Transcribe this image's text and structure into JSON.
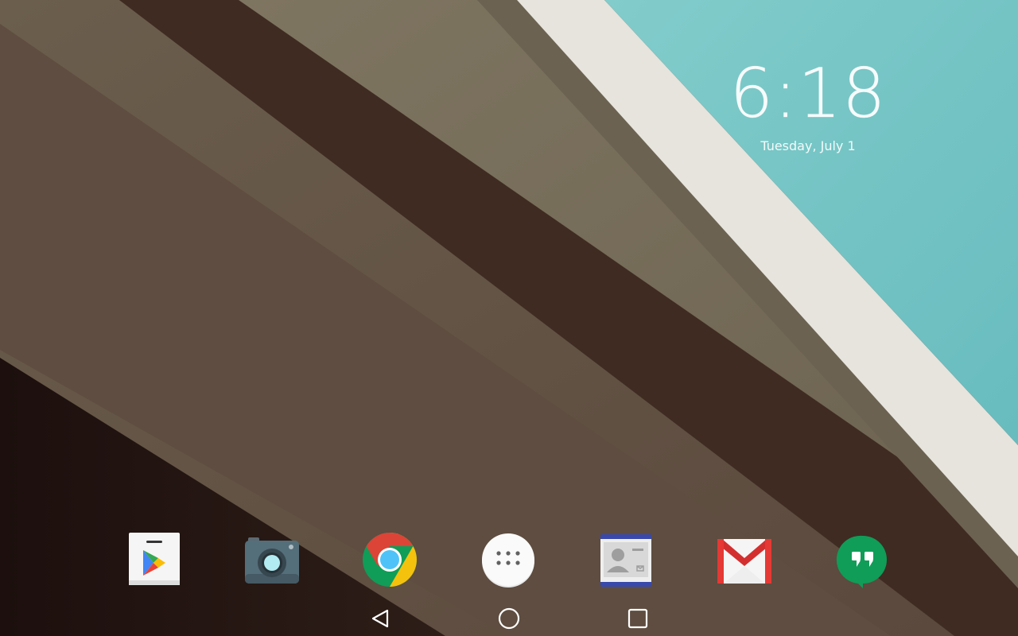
{
  "lockscreen_clock": {
    "time": "6:18",
    "date": "Tuesday, July 1"
  },
  "dock": {
    "apps": [
      {
        "name": "play-store-icon"
      },
      {
        "name": "camera-icon"
      },
      {
        "name": "chrome-icon"
      },
      {
        "name": "app-drawer-icon"
      },
      {
        "name": "contacts-icon"
      },
      {
        "name": "gmail-icon"
      },
      {
        "name": "hangouts-icon"
      }
    ]
  },
  "nav_bar": {
    "buttons": [
      {
        "name": "back-icon"
      },
      {
        "name": "home-icon"
      },
      {
        "name": "recents-icon"
      }
    ]
  },
  "colors": {
    "wallpaper_teal": "#79c7c7",
    "wallpaper_cream": "#e7e5df",
    "wallpaper_taupe": "#7a705f",
    "wallpaper_dark_brown": "#3d2a21",
    "wallpaper_mid_brown": "#5a4a3f",
    "chrome_red": "#db4437",
    "chrome_yellow": "#f4c20d",
    "chrome_green": "#0f9d58",
    "chrome_blue": "#4fc3f7",
    "gmail_red": "#e53935",
    "hangouts_green": "#0f9d58"
  }
}
